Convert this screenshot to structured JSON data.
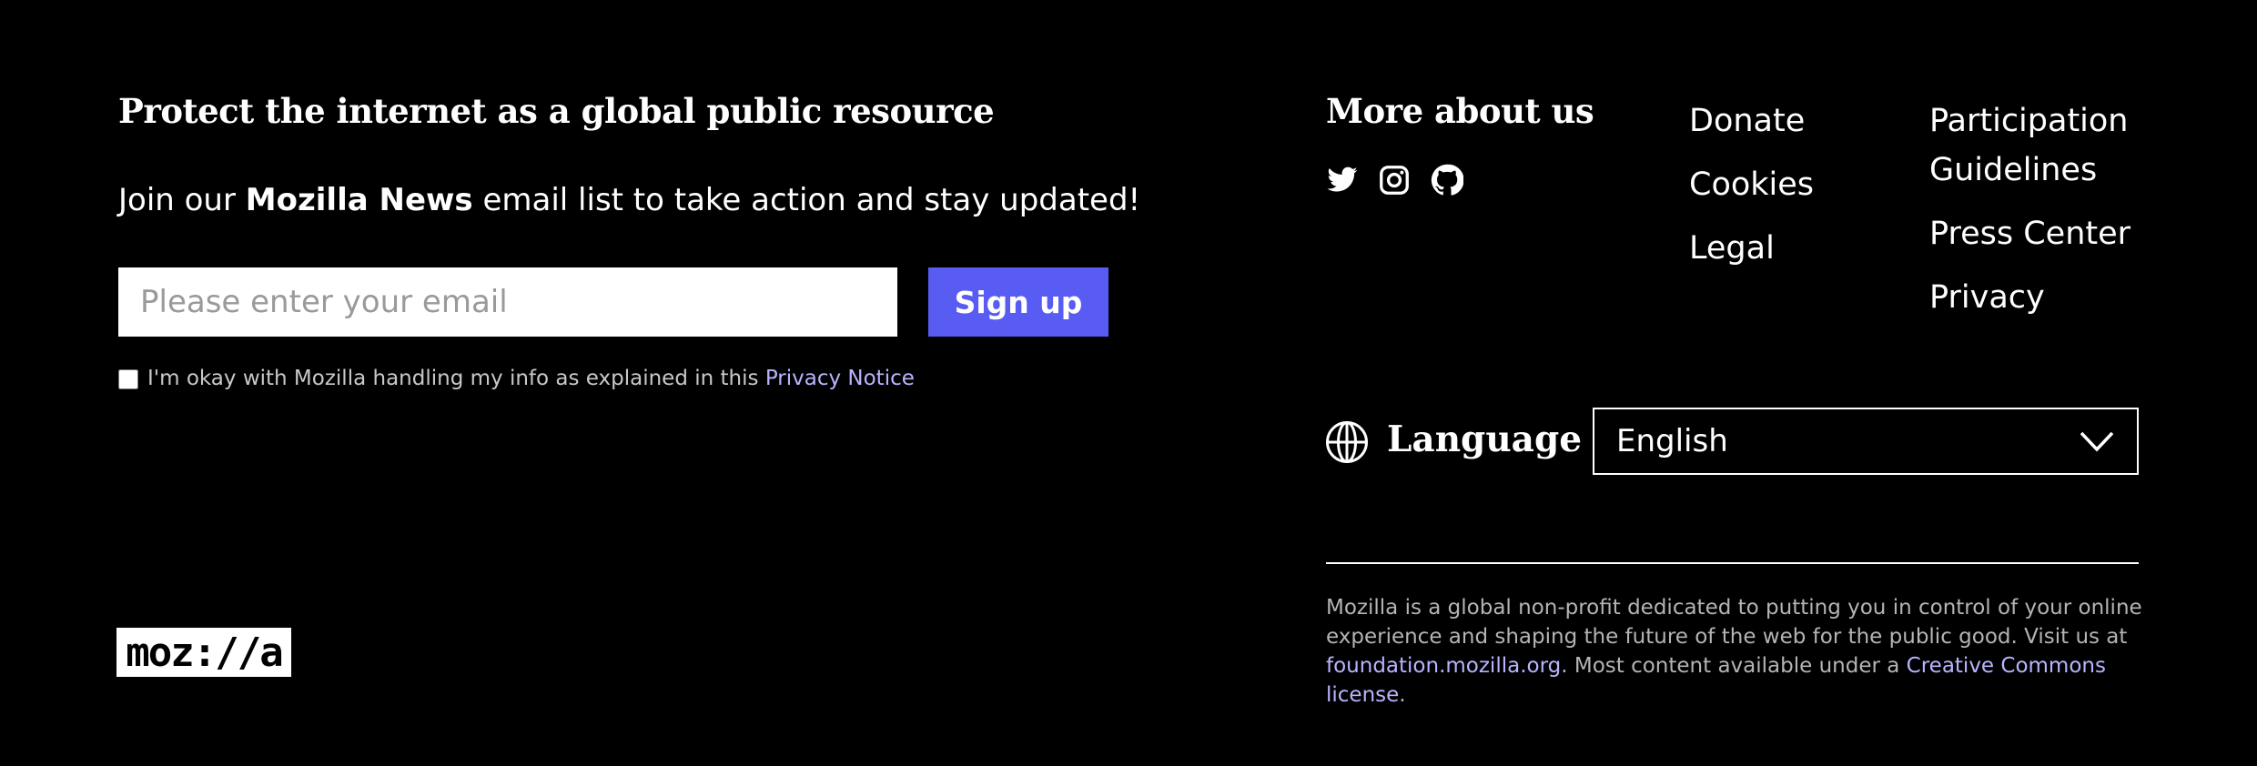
{
  "newsletter": {
    "headline": "Protect the internet as a global public resource",
    "intro_before": "Join our ",
    "intro_bold": "Mozilla News",
    "intro_after": " email list to take action and stay updated!",
    "email_placeholder": "Please enter your email",
    "email_value": "",
    "signup_label": "Sign up",
    "consent_text": "I'm okay with Mozilla handling my info as explained in this ",
    "consent_link": "Privacy Notice",
    "consent_checked": false
  },
  "logo": {
    "text": "moz://a"
  },
  "more": {
    "heading": "More about us",
    "social_icons": [
      "twitter-icon",
      "instagram-icon",
      "github-icon"
    ],
    "links_col1": [
      "Donate",
      "Cookies",
      "Legal"
    ],
    "links_col2": [
      "Participation",
      "Guidelines",
      "Press Center",
      "Privacy"
    ]
  },
  "language": {
    "label": "Language",
    "selected": "English",
    "icon": "globe-icon"
  },
  "about": {
    "text_before": "Mozilla is a global non-profit dedicated to putting you in control of your online experience and shaping the future of the web for the public good. Visit us at ",
    "link1": "foundation.mozilla.org",
    "text_middle": ". Most content available under a ",
    "link2": "Creative Commons license",
    "text_after": "."
  },
  "colors": {
    "background": "#000000",
    "accent": "#595cf3",
    "link": "#b7b4ff",
    "muted_text": "#b4b4b4"
  }
}
